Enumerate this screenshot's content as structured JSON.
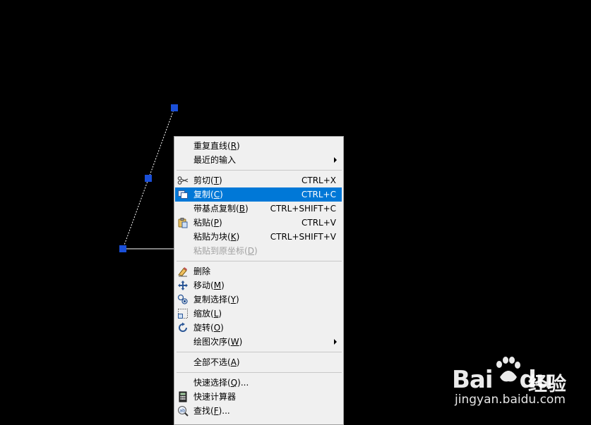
{
  "menu": {
    "groups": [
      [
        {
          "label": "重复直线",
          "key": "R",
          "shortcut": "",
          "icon": "",
          "submenu": false,
          "disabled": false
        },
        {
          "label": "最近的输入",
          "key": "",
          "shortcut": "",
          "icon": "",
          "submenu": true,
          "disabled": false
        }
      ],
      [
        {
          "label": "剪切",
          "key": "T",
          "shortcut": "CTRL+X",
          "icon": "scissors-icon",
          "submenu": false,
          "disabled": false
        },
        {
          "label": "复制",
          "key": "C",
          "shortcut": "CTRL+C",
          "icon": "copy-icon",
          "submenu": false,
          "disabled": false,
          "highlighted": true
        },
        {
          "label": "带基点复制",
          "key": "B",
          "shortcut": "CTRL+SHIFT+C",
          "icon": "",
          "submenu": false,
          "disabled": false
        },
        {
          "label": "粘贴",
          "key": "P",
          "shortcut": "CTRL+V",
          "icon": "paste-icon",
          "submenu": false,
          "disabled": false
        },
        {
          "label": "粘贴为块",
          "key": "K",
          "shortcut": "CTRL+SHIFT+V",
          "icon": "",
          "submenu": false,
          "disabled": false
        },
        {
          "label": "粘贴到原坐标",
          "key": "D",
          "shortcut": "",
          "icon": "",
          "submenu": false,
          "disabled": true
        }
      ],
      [
        {
          "label": "删除",
          "key": "",
          "shortcut": "",
          "icon": "eraser-icon",
          "submenu": false,
          "disabled": false
        },
        {
          "label": "移动",
          "key": "M",
          "shortcut": "",
          "icon": "move-icon",
          "submenu": false,
          "disabled": false
        },
        {
          "label": "复制选择",
          "key": "Y",
          "shortcut": "",
          "icon": "copy-selection-icon",
          "submenu": false,
          "disabled": false
        },
        {
          "label": "缩放",
          "key": "L",
          "shortcut": "",
          "icon": "scale-icon",
          "submenu": false,
          "disabled": false
        },
        {
          "label": "旋转",
          "key": "O",
          "shortcut": "",
          "icon": "rotate-icon",
          "submenu": false,
          "disabled": false
        },
        {
          "label": "绘图次序",
          "key": "W",
          "shortcut": "",
          "icon": "",
          "submenu": true,
          "disabled": false
        }
      ],
      [
        {
          "label": "全部不选",
          "key": "A",
          "shortcut": "",
          "icon": "",
          "submenu": false,
          "disabled": false
        }
      ],
      [
        {
          "label": "快速选择",
          "key": "Q",
          "suffix": "...",
          "shortcut": "",
          "icon": "",
          "submenu": false,
          "disabled": false
        },
        {
          "label": "快速计算器",
          "key": "",
          "shortcut": "",
          "icon": "calculator-icon",
          "submenu": false,
          "disabled": false
        },
        {
          "label": "查找",
          "key": "F",
          "suffix": "...",
          "shortcut": "",
          "icon": "find-icon",
          "submenu": false,
          "disabled": false
        }
      ]
    ]
  },
  "colors": {
    "menu_bg": "#f0f0f0",
    "highlight": "#0078d7",
    "grip": "#1a4fd8",
    "canvas": "#000000"
  },
  "watermark": {
    "brand": "Bai",
    "brand2": "du",
    "cn": "经验",
    "url": "jingyan.baidu.com"
  }
}
